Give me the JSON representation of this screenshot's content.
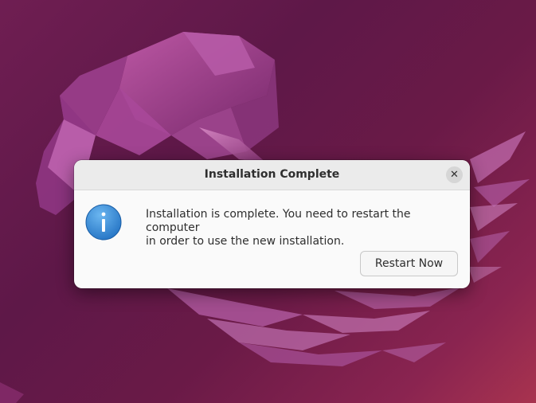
{
  "dialog": {
    "title": "Installation Complete",
    "message_line1": "Installation is complete. You need to restart the computer",
    "message_line2": "in order to use the new installation.",
    "restart_label": "Restart Now",
    "close_glyph": "✕",
    "icon": "info-icon"
  },
  "colors": {
    "wallpaper_base": "#6f1e52",
    "wallpaper_accent": "#a8334f",
    "dialog_bg": "#fafafa",
    "titlebar_bg": "#ebebeb",
    "info_icon_blue": "#2f86d6"
  }
}
